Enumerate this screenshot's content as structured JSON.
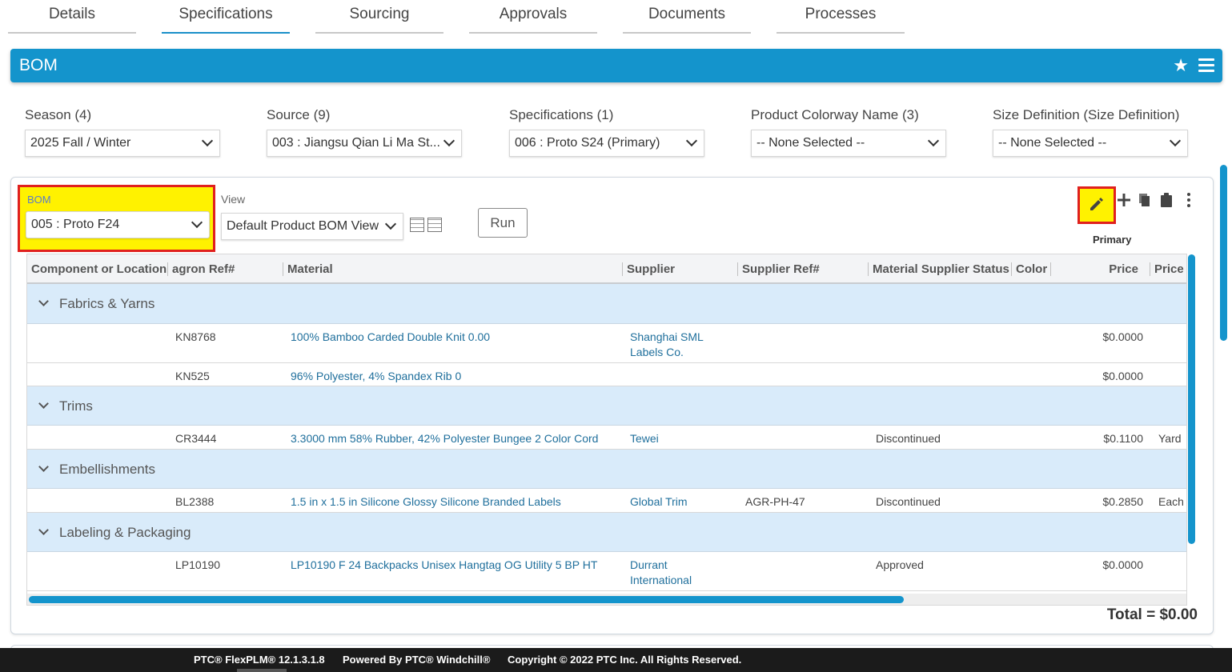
{
  "tabs": [
    {
      "label": "Details"
    },
    {
      "label": "Specifications"
    },
    {
      "label": "Sourcing"
    },
    {
      "label": "Approvals"
    },
    {
      "label": "Documents"
    },
    {
      "label": "Processes"
    }
  ],
  "header": {
    "title": "BOM",
    "star_icon": "star-icon",
    "menu_icon": "hamburger-menu-icon"
  },
  "filters": [
    {
      "label": "Season (4)",
      "value": "2025 Fall / Winter"
    },
    {
      "label": "Source (9)",
      "value": "003 : Jiangsu Qian Li Ma St..."
    },
    {
      "label": "Specifications (1)",
      "value": "006 : Proto S24 (Primary)"
    },
    {
      "label": "Product Colorway Name (3)",
      "value": "-- None Selected --"
    },
    {
      "label": "Size Definition (Size Definition)",
      "value": "-- None Selected --"
    }
  ],
  "bom_panel": {
    "bom_label": "BOM",
    "bom_value": "005 : Proto F24",
    "view_label": "View",
    "view_value": "Default Product BOM View",
    "run_label": "Run",
    "primary_label": "Primary",
    "total": "Total = $0.00"
  },
  "accent_color": "#1494cc",
  "highlight_color": "#fff200",
  "table": {
    "columns": [
      "Component or Location",
      "agron Ref#",
      "Material",
      "Supplier",
      "Supplier Ref#",
      "Material Supplier Status",
      "Color",
      "Price",
      "Price U"
    ],
    "groups": [
      {
        "name": "Fabrics & Yarns",
        "rows": [
          {
            "ref": "KN8768",
            "material": "100% Bamboo Carded Double Knit 0.00",
            "supplier": [
              "Shanghai SML",
              "Labels Co."
            ],
            "supplier_ref": "",
            "status": "",
            "price": "$0.0000",
            "unit": ""
          },
          {
            "ref": "KN525",
            "material": "96% Polyester, 4% Spandex Rib 0",
            "supplier": [
              ""
            ],
            "supplier_ref": "",
            "status": "",
            "price": "$0.0000",
            "unit": ""
          }
        ]
      },
      {
        "name": "Trims",
        "rows": [
          {
            "ref": "CR3444",
            "material": "3.3000 mm 58% Rubber, 42% Polyester Bungee 2 Color Cord",
            "supplier": [
              "Tewei"
            ],
            "supplier_ref": "",
            "status": "Discontinued",
            "price": "$0.1100",
            "unit": "Yard"
          }
        ]
      },
      {
        "name": "Embellishments",
        "rows": [
          {
            "ref": "BL2388",
            "material": "1.5 in x 1.5 in Silicone Glossy Silicone Branded Labels",
            "supplier": [
              "Global Trim"
            ],
            "supplier_ref": "AGR-PH-47",
            "status": "Discontinued",
            "price": "$0.2850",
            "unit": "Each"
          }
        ]
      },
      {
        "name": "Labeling & Packaging",
        "rows": [
          {
            "ref": "LP10190",
            "material": "LP10190 F 24 Backpacks Unisex Hangtag OG Utility 5 BP HT",
            "supplier": [
              "Durrant",
              "International"
            ],
            "supplier_ref": "",
            "status": "Approved",
            "price": "$0.0000",
            "unit": ""
          }
        ]
      }
    ]
  },
  "footer": {
    "version": "PTC® FlexPLM® 12.1.3.1.8",
    "powered": "Powered By PTC® Windchill®",
    "copyright": "Copyright © 2022 PTC Inc. All Rights Reserved."
  }
}
